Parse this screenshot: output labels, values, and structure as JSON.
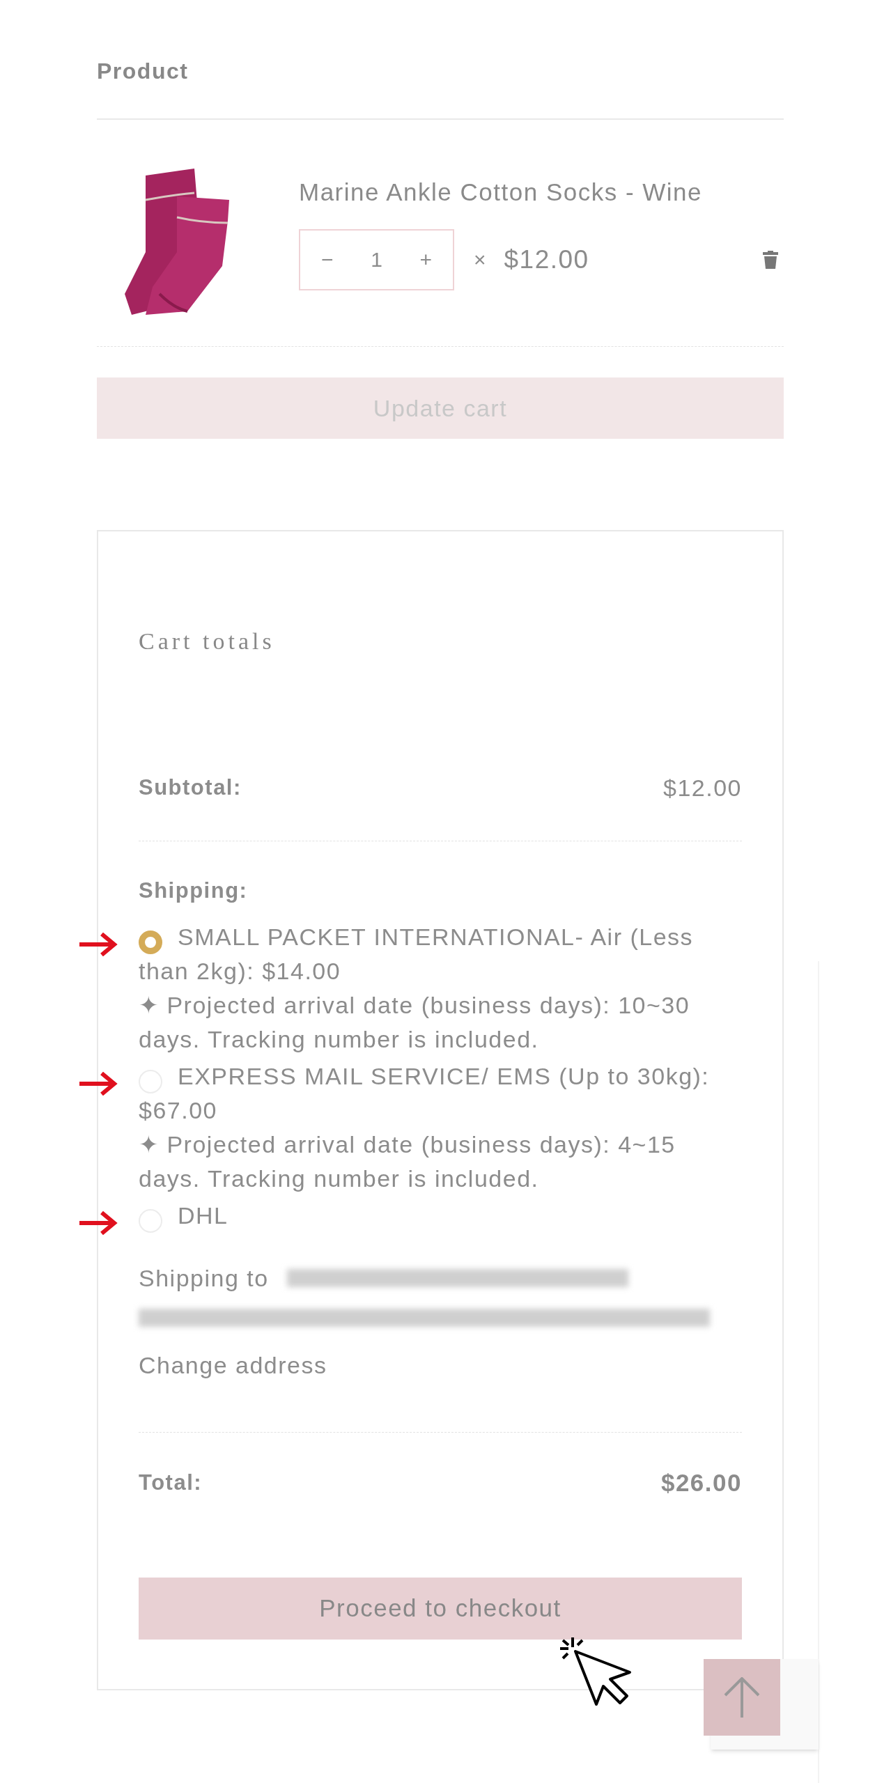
{
  "cart_table": {
    "header": "Product"
  },
  "product": {
    "name": "Marine Ankle Cotton Socks - Wine",
    "decrement": "−",
    "quantity": "1",
    "increment": "+",
    "times": "×",
    "price": "$12.00"
  },
  "update_cart": {
    "label": "Update cart",
    "disabled": true
  },
  "cart_totals": {
    "title": "Cart totals",
    "subtotal_label": "Subtotal:",
    "subtotal": "$12.00",
    "shipping_label": "Shipping:",
    "shipping_options": [
      {
        "label": "SMALL PACKET INTERNATIONAL- Air (Less than 2kg): $14.00",
        "note": "✦ Projected arrival date (business days): 10~30 days. Tracking number is included.",
        "selected": true
      },
      {
        "label": "EXPRESS MAIL SERVICE/ EMS (Up to 30kg): $67.00",
        "note": "✦ Projected arrival date (business days): 4~15 days. Tracking number is included.",
        "selected": false
      },
      {
        "label": "DHL",
        "selected": false
      }
    ],
    "shipping_to_label": "Shipping to",
    "change_address": "Change address",
    "total_label": "Total:",
    "total": "$26.00",
    "checkout": "Proceed to checkout"
  }
}
